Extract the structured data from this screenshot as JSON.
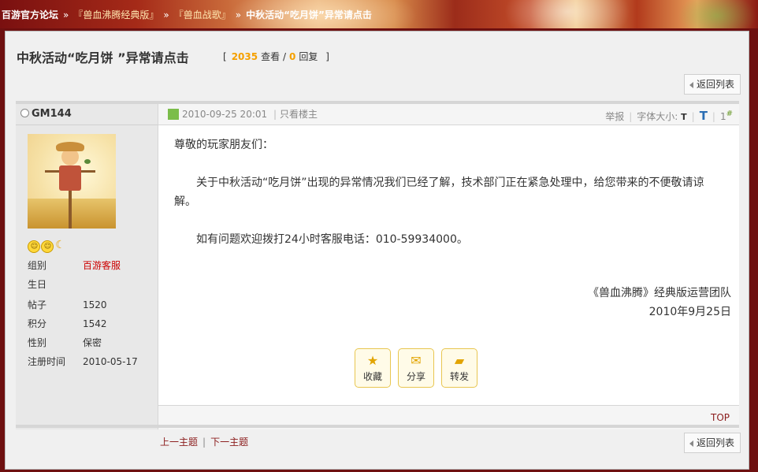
{
  "breadcrumb": {
    "home": "百游官方论坛",
    "sep": "»",
    "forum": "『兽血沸腾经典版』",
    "board": "『兽血战歌』",
    "current": "中秋活动“吃月饼”异常请点击"
  },
  "topic": {
    "title": "中秋活动“吃月饼 ”异常请点击",
    "bracket_open": "[",
    "bracket_close": "]",
    "views": "2035",
    "views_label": "查看",
    "slash": "/",
    "replies": "0",
    "replies_label": "回复"
  },
  "buttons": {
    "back_to_list": "返回列表",
    "back_to_list_bottom": "返回列表"
  },
  "author": {
    "name": "GM144",
    "groups": [
      {
        "k": "组别",
        "v": "百游客服"
      },
      {
        "k": "生日",
        "v": ""
      },
      {
        "k": "帖子",
        "v": "1520"
      },
      {
        "k": "积分",
        "v": "1542"
      },
      {
        "k": "性别",
        "v": "保密"
      },
      {
        "k": "注册时间",
        "v": "2010-05-17"
      }
    ]
  },
  "post": {
    "datetime": "2010-09-25 20:01",
    "only_author": "只看楼主",
    "report": "举报",
    "font_size_label": "字体大小:",
    "font_small": "T",
    "font_big": "T",
    "floor": "1",
    "floor_sup": "#",
    "greeting": "尊敬的玩家朋友们：",
    "paragraph1": "关于中秋活动“吃月饼”出现的异常情况我们已经了解，技术部门正在紧急处理中，给您带来的不便敬请谅解。",
    "paragraph2": "如有问题欢迎拨打24小时客服电话：010-59934000。",
    "signature_team": "《兽血沸腾》经典版运营团队",
    "signature_date": "2010年9月25日",
    "actions": {
      "favorite": "收藏",
      "share": "分享",
      "forward": "转发"
    },
    "top_link": "TOP"
  },
  "bottom_nav": {
    "prev": "上一主题",
    "sep": "|",
    "next": "下一主题"
  }
}
